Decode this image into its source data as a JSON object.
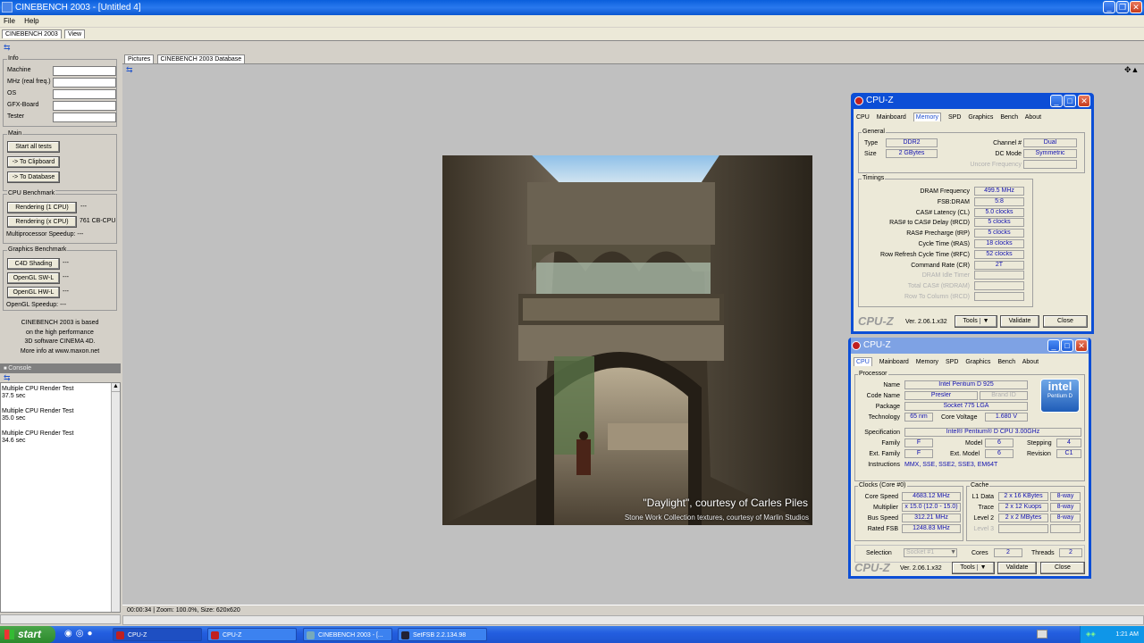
{
  "window": {
    "title": "CINEBENCH 2003 - [Untitled 4]"
  },
  "menu": {
    "file": "File",
    "help": "Help"
  },
  "top_tabs": [
    "CINEBENCH 2003",
    "View"
  ],
  "info": {
    "label": "Info",
    "fields": [
      "Machine",
      "MHz (real freq.)",
      "OS",
      "GFX-Board",
      "Tester"
    ]
  },
  "main_group": {
    "label": "Main",
    "start_all": "Start all tests",
    "to_clipboard": "-> To Clipboard",
    "to_database": "-> To Database"
  },
  "cpu_bench": {
    "label": "CPU Benchmark",
    "render1": "Rendering (1 CPU)",
    "render1_result": "---",
    "renderx": "Rendering (x CPU)",
    "renderx_result": "761 CB-CPU",
    "speedup": "Multiprocessor Speedup: ---"
  },
  "gfx_bench": {
    "label": "Graphics Benchmark",
    "c4d": "C4D Shading",
    "c4d_result": "---",
    "swl": "OpenGL SW-L",
    "swl_result": "---",
    "hwl": "OpenGL HW-L",
    "hwl_result": "---",
    "speedup": "OpenGL Speedup: ---"
  },
  "about_note": [
    "CINEBENCH 2003 is based",
    "on the high performance",
    "3D software CINEMA 4D.",
    "More info at www.maxon.net"
  ],
  "console": {
    "header": "Console",
    "entries": [
      {
        "title": "Multiple CPU Render Test",
        "time": "37.5 sec"
      },
      {
        "title": "Multiple CPU Render Test",
        "time": "35.0 sec"
      },
      {
        "title": "Multiple CPU Render Test",
        "time": "34.6 sec"
      }
    ]
  },
  "viewer_tabs": [
    "Pictures",
    "CINEBENCH 2003 Database"
  ],
  "render": {
    "caption1": "\"Daylight\", courtesy of Carles Piles",
    "caption2": "Stone Work Collection textures, courtesy of Marlin Studios"
  },
  "statusbar": "00:00:34 | Zoom: 100.0%, Size: 620x620",
  "cpuz_memory": {
    "title": "CPU-Z",
    "tabs": [
      "CPU",
      "Mainboard",
      "Memory",
      "SPD",
      "Graphics",
      "Bench",
      "About"
    ],
    "general": "General",
    "type_label": "Type",
    "type": "DDR2",
    "size_label": "Size",
    "size": "2 GBytes",
    "channel_label": "Channel #",
    "channel": "Dual",
    "dcmode_label": "DC Mode",
    "dcmode": "Symmetric",
    "uncore_label": "Uncore Frequency",
    "timings": "Timings",
    "rows": [
      {
        "label": "DRAM Frequency",
        "value": "499.5 MHz"
      },
      {
        "label": "FSB:DRAM",
        "value": "5:8"
      },
      {
        "label": "CAS# Latency (CL)",
        "value": "5.0 clocks"
      },
      {
        "label": "RAS# to CAS# Delay (tRCD)",
        "value": "5 clocks"
      },
      {
        "label": "RAS# Precharge (tRP)",
        "value": "5 clocks"
      },
      {
        "label": "Cycle Time (tRAS)",
        "value": "18 clocks"
      },
      {
        "label": "Row Refresh Cycle Time (tRFC)",
        "value": "52 clocks"
      },
      {
        "label": "Command Rate (CR)",
        "value": "2T"
      },
      {
        "label": "DRAM Idle Timer",
        "value": ""
      },
      {
        "label": "Total CAS# (tRDRAM)",
        "value": ""
      },
      {
        "label": "Row To Column (tRCD)",
        "value": ""
      }
    ],
    "brand": "CPU-Z",
    "version": "Ver. 2.06.1.x32",
    "tools": "Tools",
    "validate": "Validate",
    "close": "Close"
  },
  "cpuz_cpu": {
    "title": "CPU-Z",
    "tabs": [
      "CPU",
      "Mainboard",
      "Memory",
      "SPD",
      "Graphics",
      "Bench",
      "About"
    ],
    "processor": "Processor",
    "name_label": "Name",
    "name": "Intel Pentium D 925",
    "codename_label": "Code Name",
    "codename": "Presler",
    "brandid_label": "Brand ID",
    "package_label": "Package",
    "package": "Socket 775 LGA",
    "tech_label": "Technology",
    "tech": "65 nm",
    "voltage_label": "Core Voltage",
    "voltage": "1.680 V",
    "spec_label": "Specification",
    "spec": "Intel® Pentium® D CPU 3.00GHz",
    "family_label": "Family",
    "family": "F",
    "model_label": "Model",
    "model": "6",
    "stepping_label": "Stepping",
    "stepping": "4",
    "extfamily_label": "Ext. Family",
    "extfamily": "F",
    "extmodel_label": "Ext. Model",
    "extmodel": "6",
    "revision_label": "Revision",
    "revision": "C1",
    "instr_label": "Instructions",
    "instr": "MMX, SSE, SSE2, SSE3, EM64T",
    "intel_logo": "intel",
    "intel_sub": "Pentium D",
    "clocks": "Clocks (Core #0)",
    "corespeed_label": "Core Speed",
    "corespeed": "4683.12 MHz",
    "mult_label": "Multiplier",
    "mult": "x 15.0 (12.0 - 15.0)",
    "bus_label": "Bus Speed",
    "bus": "312.21 MHz",
    "fsb_label": "Rated FSB",
    "fsb": "1248.83 MHz",
    "cache": "Cache",
    "l1_label": "L1 Data",
    "l1": "2 x 16 KBytes",
    "l1way": "8-way",
    "trace_label": "Trace",
    "trace": "2 x 12 Kuops",
    "traceway": "8-way",
    "l2_label": "Level 2",
    "l2": "2 x 2 MBytes",
    "l2way": "8-way",
    "l3_label": "Level 3",
    "selection_label": "Selection",
    "selection": "Socket #1",
    "cores_label": "Cores",
    "cores": "2",
    "threads_label": "Threads",
    "threads": "2",
    "brand": "CPU-Z",
    "version": "Ver. 2.06.1.x32",
    "tools": "Tools",
    "validate": "Validate",
    "close": "Close"
  },
  "taskbar": {
    "start": "start",
    "tasks": [
      "CPU-Z",
      "CPU-Z",
      "CINEBENCH 2003 - [...",
      "SetFSB 2.2.134.98"
    ],
    "clock": "1:21 AM"
  },
  "colors": {
    "titlebar": "#0a5fdc",
    "taskbar": "#235ee0",
    "start": "#3a9a3a",
    "cpuz_value": "#1010b0"
  }
}
